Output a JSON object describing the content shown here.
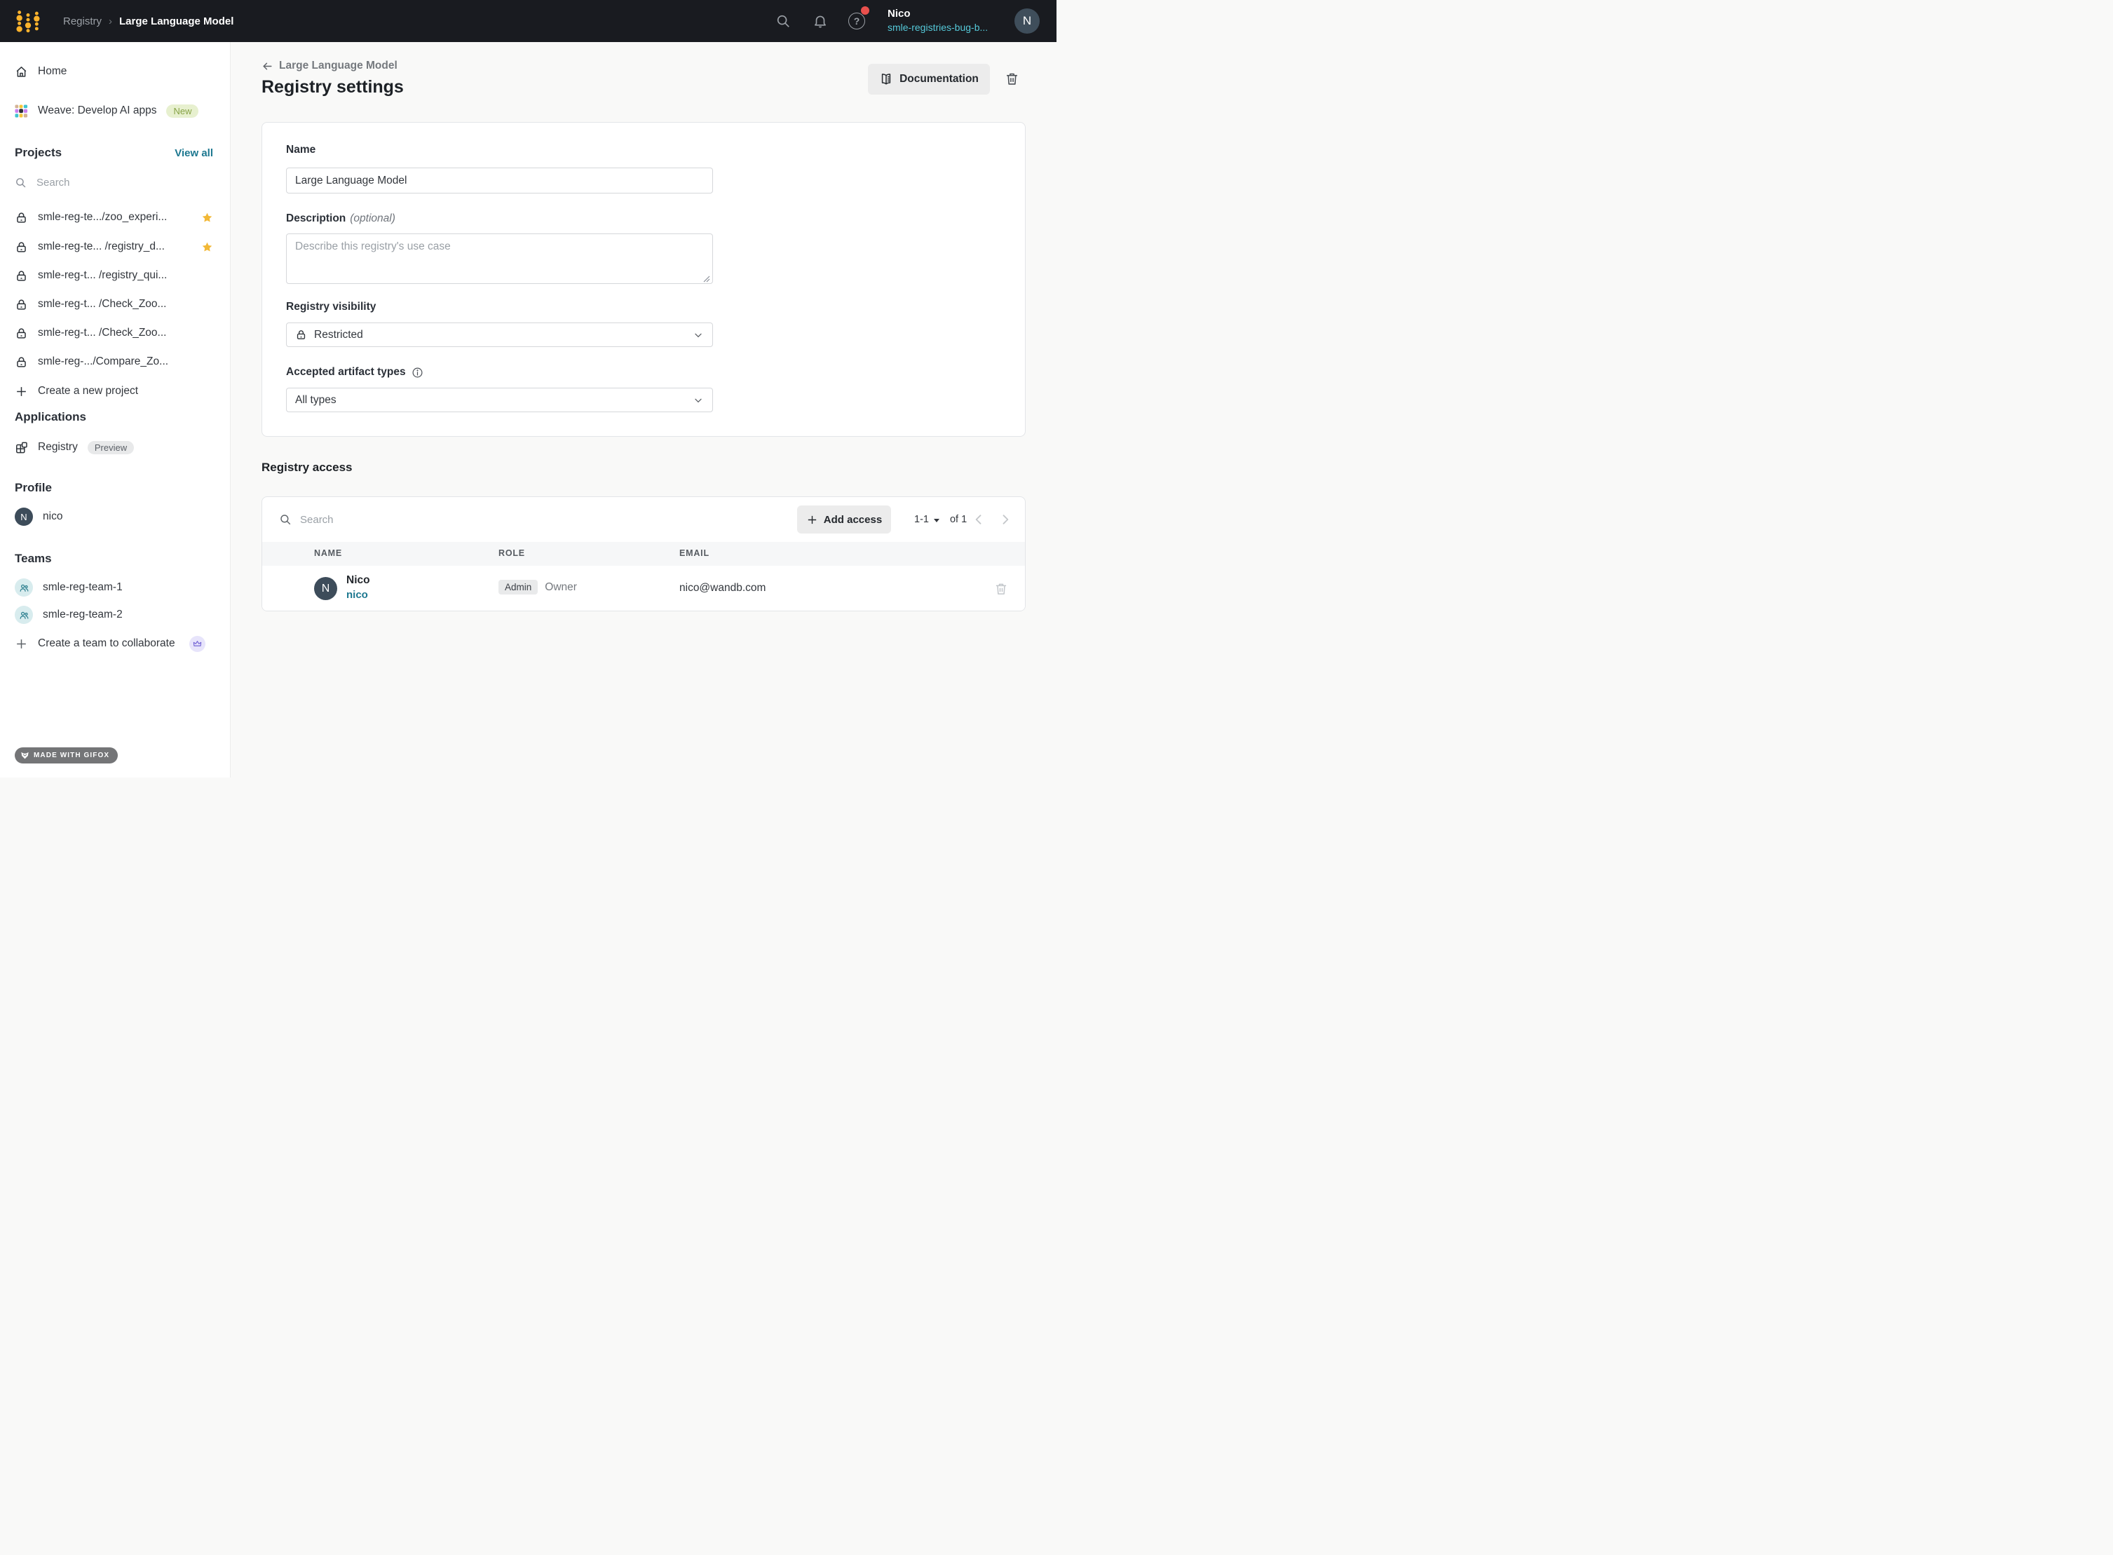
{
  "navbar": {
    "breadcrumb_root": "Registry",
    "breadcrumb_sep": "›",
    "breadcrumb_current": "Large Language Model",
    "help_glyph": "?",
    "user_name": "Nico",
    "user_org": "smle-registries-bug-b...",
    "avatar_initial": "N"
  },
  "sidebar": {
    "home_label": "Home",
    "weave_label": "Weave: Develop AI apps",
    "weave_badge": "New",
    "projects_header": "Projects",
    "view_all": "View all",
    "search_placeholder": "Search",
    "projects": [
      {
        "label": "smle-reg-te.../zoo_experi...",
        "starred": true
      },
      {
        "label": "smle-reg-te... /registry_d...",
        "starred": true
      },
      {
        "label": "smle-reg-t... /registry_qui...",
        "starred": false
      },
      {
        "label": "smle-reg-t... /Check_Zoo...",
        "starred": false
      },
      {
        "label": "smle-reg-t... /Check_Zoo...",
        "starred": false
      },
      {
        "label": "smle-reg-.../Compare_Zo...",
        "starred": false
      }
    ],
    "create_project": "Create a new project",
    "applications_header": "Applications",
    "registry_label": "Registry",
    "registry_badge": "Preview",
    "profile_header": "Profile",
    "profile_initial": "N",
    "profile_name": "nico",
    "teams_header": "Teams",
    "teams": [
      "smle-reg-team-1",
      "smle-reg-team-2"
    ],
    "create_team": "Create a team to collaborate",
    "made_with": "MADE WITH GIFOX"
  },
  "main": {
    "back_label": "Large Language Model",
    "title": "Registry settings",
    "documentation_label": "Documentation",
    "form": {
      "name_label": "Name",
      "name_value": "Large Language Model",
      "description_label": "Description",
      "description_optional": "(optional)",
      "description_placeholder": "Describe this registry's use case",
      "visibility_label": "Registry visibility",
      "visibility_value": "Restricted",
      "types_label": "Accepted artifact types",
      "types_value": "All types"
    },
    "access": {
      "heading": "Registry access",
      "search_placeholder": "Search",
      "add_access_label": "Add access",
      "pagination_range": "1-1",
      "pagination_of": "of 1",
      "col_name": "NAME",
      "col_role": "ROLE",
      "col_email": "EMAIL",
      "rows": [
        {
          "avatar_initial": "N",
          "name": "Nico",
          "username": "nico",
          "role_badge": "Admin",
          "role_extra": "Owner",
          "email": "nico@wandb.com"
        }
      ]
    }
  },
  "colors": {
    "navbar_bg": "#191b20",
    "brand_yellow": "#fcb32c",
    "link_teal": "#1d7890",
    "navbar_cyan": "#55c9d9",
    "star_yellow": "#f2b836",
    "notification_red": "#e9504d",
    "avatar_slate": "#3d4c5a"
  }
}
